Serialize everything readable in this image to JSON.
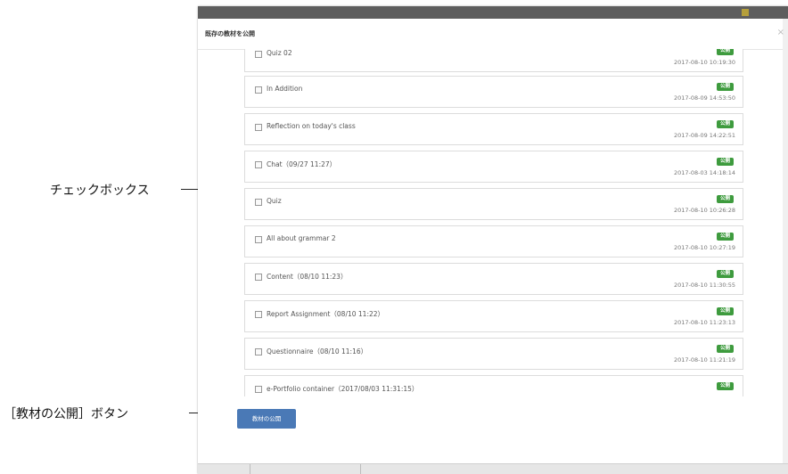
{
  "callouts": {
    "checkbox": "チェックボックス",
    "publish_button": "［教材の公開］ボタン"
  },
  "modal": {
    "title": "既存の教材を公開",
    "close": "×",
    "publish_button": "教材の公開"
  },
  "items": [
    {
      "title": "Quiz 02",
      "badge": "公開",
      "date": "2017-08-10 10:19:30"
    },
    {
      "title": "In Addition",
      "badge": "公開",
      "date": "2017-08-09 14:53:50"
    },
    {
      "title": "Reflection on today's class",
      "badge": "公開",
      "date": "2017-08-09 14:22:51"
    },
    {
      "title": "Chat（09/27 11:27）",
      "badge": "公開",
      "date": "2017-08-03 14:18:14"
    },
    {
      "title": "Quiz",
      "badge": "公開",
      "date": "2017-08-10 10:26:28"
    },
    {
      "title": "All about grammar 2",
      "badge": "公開",
      "date": "2017-08-10 10:27:19"
    },
    {
      "title": "Content（08/10 11:23）",
      "badge": "公開",
      "date": "2017-08-10 11:30:55"
    },
    {
      "title": "Report Assignment（08/10 11:22）",
      "badge": "公開",
      "date": "2017-08-10 11:23:13"
    },
    {
      "title": "Questionnaire（08/10 11:16）",
      "badge": "公開",
      "date": "2017-08-10 11:21:19"
    },
    {
      "title": "e-Portfolio container（2017/08/03 11:31:15）",
      "badge": "公開",
      "date": ""
    }
  ],
  "colors": {
    "badge": "#3e9b3e",
    "publish_button": "#4a79b6"
  }
}
